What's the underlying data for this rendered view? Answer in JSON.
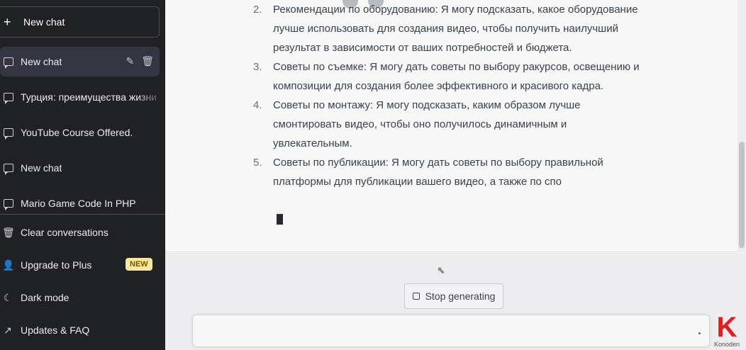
{
  "sidebar": {
    "new_chat_label": "New chat",
    "history": [
      {
        "label": "New chat",
        "active": true
      },
      {
        "label": "Турция: преимущества жизни",
        "active": false
      },
      {
        "label": "YouTube Course Offered.",
        "active": false
      },
      {
        "label": "New chat",
        "active": false
      },
      {
        "label": "Mario Game Code In PHP",
        "active": false
      }
    ],
    "menu": [
      {
        "label": "Clear conversations",
        "icon": "trash-icon"
      },
      {
        "label": "Upgrade to Plus",
        "icon": "user-icon",
        "badge": "NEW"
      },
      {
        "label": "Dark mode",
        "icon": "moon-icon"
      },
      {
        "label": "Updates & FAQ",
        "icon": "external-link-icon"
      }
    ]
  },
  "response": {
    "items": [
      {
        "num": "2.",
        "text": "Рекомендации по оборудованию: Я могу подсказать, какое оборудование лучше использовать для создания видео, чтобы получить наилучший результат в зависимости от ваших потребностей и бюджета."
      },
      {
        "num": "3.",
        "text": "Советы по съемке: Я могу дать советы по выбору ракурсов, освещению и композиции для создания более эффективного и красивого кадра."
      },
      {
        "num": "4.",
        "text": "Советы по монтажу: Я могу подсказать, каким образом лучше смонтировать видео, чтобы оно получилось динамичным и увлекательным."
      },
      {
        "num": "5.",
        "text": "Советы по публикации: Я могу дать советы по выбору правильной платформы для публикации вашего видео, а также по спо"
      }
    ]
  },
  "controls": {
    "stop_label": "Stop generating"
  },
  "watermark": {
    "letter": "K",
    "text": "Konoden"
  }
}
